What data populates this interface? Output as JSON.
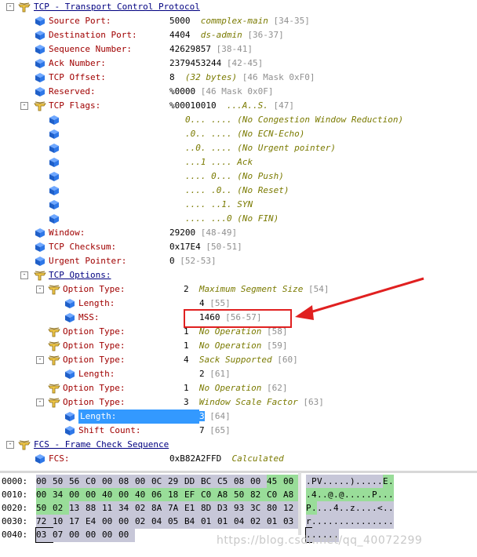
{
  "tree": [
    {
      "level": 0,
      "toggle": "-",
      "icon": "shark",
      "label": "TCP - Transport Control Protocol",
      "header": true
    },
    {
      "level": 1,
      "icon": "cube",
      "label": "Source Port:",
      "value": "5000",
      "ann": "commplex-main",
      "off": "[34-35]"
    },
    {
      "level": 1,
      "icon": "cube",
      "label": "Destination Port:",
      "value": "4404",
      "ann": "ds-admin",
      "off": "[36-37]"
    },
    {
      "level": 1,
      "icon": "cube",
      "label": "Sequence Number:",
      "value": "42629857",
      "off": "[38-41]"
    },
    {
      "level": 1,
      "icon": "cube",
      "label": "Ack Number:",
      "value": "2379453244",
      "off": "[42-45]"
    },
    {
      "level": 1,
      "icon": "cube",
      "label": "TCP Offset:",
      "value": "8",
      "ann": "(32 bytes)",
      "off": "[46 Mask 0xF0]"
    },
    {
      "level": 1,
      "icon": "cube",
      "label": "Reserved:",
      "value": "%0000",
      "off": "[46 Mask 0x0F]"
    },
    {
      "level": 1,
      "toggle": "-",
      "icon": "shark",
      "label": "TCP Flags:",
      "value": "%00010010",
      "ann": "...A..S.",
      "off": "[47]"
    },
    {
      "level": 2,
      "icon": "cube",
      "flag": "0... ....",
      "ann": "(No Congestion Window Reduction)"
    },
    {
      "level": 2,
      "icon": "cube",
      "flag": ".0.. ....",
      "ann": "(No ECN-Echo)"
    },
    {
      "level": 2,
      "icon": "cube",
      "flag": "..0. ....",
      "ann": "(No Urgent pointer)"
    },
    {
      "level": 2,
      "icon": "cube",
      "flag": "...1 ....",
      "ann": "Ack"
    },
    {
      "level": 2,
      "icon": "cube",
      "flag": ".... 0...",
      "ann": "(No Push)"
    },
    {
      "level": 2,
      "icon": "cube",
      "flag": ".... .0..",
      "ann": "(No Reset)"
    },
    {
      "level": 2,
      "icon": "cube",
      "flag": ".... ..1.",
      "ann": "SYN"
    },
    {
      "level": 2,
      "icon": "cube",
      "flag": ".... ...0",
      "ann": "(No FIN)"
    },
    {
      "level": 1,
      "icon": "cube",
      "label": "Window:",
      "value": "29200",
      "off": "[48-49]"
    },
    {
      "level": 1,
      "icon": "cube",
      "label": "TCP Checksum:",
      "value": "0x17E4",
      "off": "[50-51]"
    },
    {
      "level": 1,
      "icon": "cube",
      "label": "Urgent Pointer:",
      "value": "0",
      "off": "[52-53]"
    },
    {
      "level": 1,
      "toggle": "-",
      "icon": "shark",
      "label": "TCP Options:",
      "header": true
    },
    {
      "level": 2,
      "toggle": "-",
      "icon": "shark",
      "label": "Option Type:",
      "value": "2",
      "ann": "Maximum Segment Size",
      "off": "[54]"
    },
    {
      "level": 3,
      "icon": "cube",
      "label": "Length:",
      "value": "4",
      "off": "[55]"
    },
    {
      "level": 3,
      "icon": "cube",
      "label": "MSS:",
      "value": "1460",
      "off": "[56-57]"
    },
    {
      "level": 2,
      "icon": "shark",
      "label": "Option Type:",
      "value": "1",
      "ann": "No Operation",
      "off": "[58]"
    },
    {
      "level": 2,
      "icon": "shark",
      "label": "Option Type:",
      "value": "1",
      "ann": "No Operation",
      "off": "[59]"
    },
    {
      "level": 2,
      "toggle": "-",
      "icon": "shark",
      "label": "Option Type:",
      "value": "4",
      "ann": "Sack Supported",
      "off": "[60]"
    },
    {
      "level": 3,
      "icon": "cube",
      "label": "Length:",
      "value": "2",
      "off": "[61]"
    },
    {
      "level": 2,
      "icon": "shark",
      "label": "Option Type:",
      "value": "1",
      "ann": "No Operation",
      "off": "[62]"
    },
    {
      "level": 2,
      "toggle": "-",
      "icon": "shark",
      "label": "Option Type:",
      "value": "3",
      "ann": "Window Scale Factor",
      "off": "[63]"
    },
    {
      "level": 3,
      "icon": "cube",
      "label": "Length:",
      "value": "3",
      "off": "[64]",
      "selected": true
    },
    {
      "level": 3,
      "icon": "cube",
      "label": "Shift Count:",
      "value": "7",
      "off": "[65]"
    },
    {
      "level": 0,
      "toggle": "-",
      "icon": "shark",
      "label": "FCS - Frame Check Sequence",
      "header": true
    },
    {
      "level": 1,
      "icon": "cube",
      "label": "FCS:",
      "value": "0xB82A2FFD",
      "ann": "Calculated"
    }
  ],
  "hex": [
    {
      "addr": "0000:",
      "bytes": [
        "00",
        "50",
        "56",
        "C0",
        "00",
        "08",
        "00",
        "0C",
        "29",
        "DD",
        "BC",
        "C5",
        "08",
        "00",
        "45",
        "00"
      ],
      "ascii": ".PV.....).....E."
    },
    {
      "addr": "0010:",
      "bytes": [
        "00",
        "34",
        "00",
        "00",
        "40",
        "00",
        "40",
        "06",
        "18",
        "EF",
        "C0",
        "A8",
        "50",
        "82",
        "C0",
        "A8"
      ],
      "ascii": ".4..@.@.....P..."
    },
    {
      "addr": "0020:",
      "bytes": [
        "50",
        "02",
        "13",
        "88",
        "11",
        "34",
        "02",
        "8A",
        "7A",
        "E1",
        "8D",
        "D3",
        "93",
        "3C",
        "80",
        "12"
      ],
      "ascii": "P....4..z....<.."
    },
    {
      "addr": "0030:",
      "bytes": [
        "72",
        "10",
        "17",
        "E4",
        "00",
        "00",
        "02",
        "04",
        "05",
        "B4",
        "01",
        "01",
        "04",
        "02",
        "01",
        "03"
      ],
      "ascii": "r..............."
    },
    {
      "addr": "0040:",
      "bytes": [
        "03",
        "07",
        "00",
        "00",
        "00",
        "00"
      ],
      "ascii": "......"
    }
  ],
  "hex_highlight": {
    "green_ranges": [
      [
        14,
        15
      ],
      [
        16,
        33
      ]
    ],
    "cursor_index": 64
  },
  "colors": {
    "label": "#a00000",
    "header": "#000080",
    "annotation": "#7a7a00",
    "offset": "#909090",
    "selection": "#3399ff",
    "callout": "#e02020"
  },
  "watermark": "https://blog.csdn.net/qq_40072299"
}
